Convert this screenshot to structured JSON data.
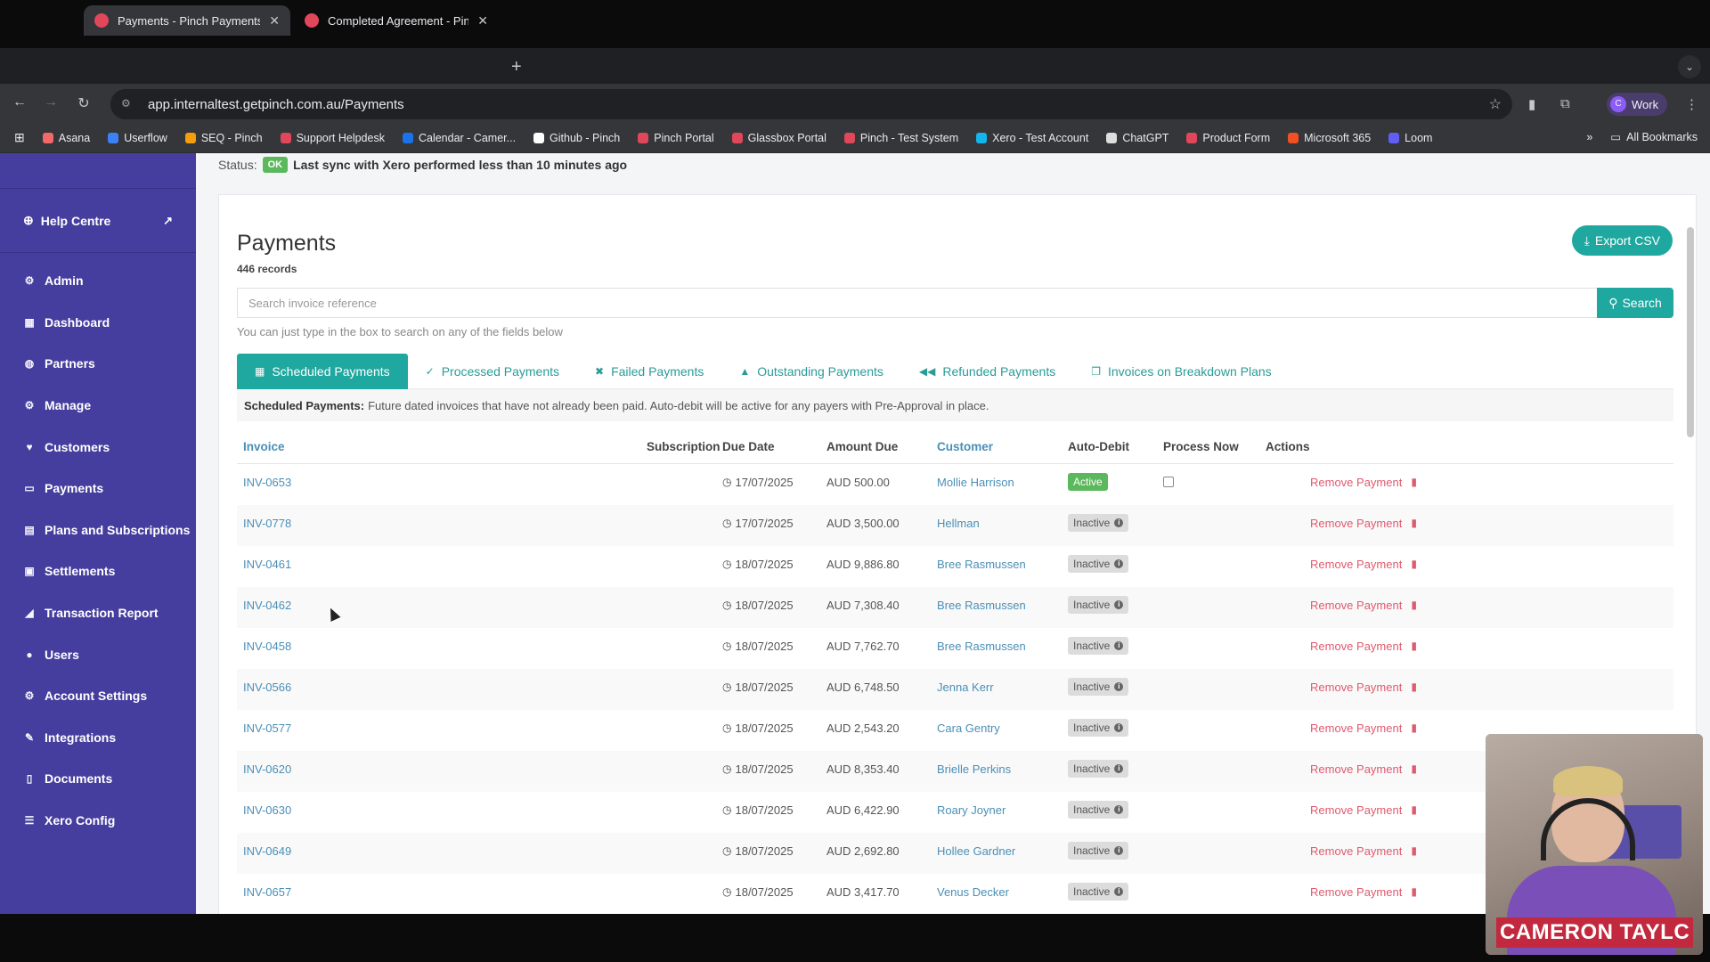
{
  "browser": {
    "tabs": [
      {
        "title": "Payments - Pinch Payments"
      },
      {
        "title": "Completed Agreement - Pinch"
      }
    ],
    "url": "app.internaltest.getpinch.com.au/Payments",
    "profile_label": "Work",
    "profile_initial": "C",
    "bookmarks": [
      {
        "label": "Asana",
        "color": "#f06a6a"
      },
      {
        "label": "Userflow",
        "color": "#3b82f6"
      },
      {
        "label": "SEQ - Pinch",
        "color": "#f59e0b"
      },
      {
        "label": "Support Helpdesk",
        "color": "#e0475b"
      },
      {
        "label": "Calendar - Camer...",
        "color": "#1a73e8"
      },
      {
        "label": "Github - Pinch",
        "color": "#ffffff"
      },
      {
        "label": "Pinch Portal",
        "color": "#e0475b"
      },
      {
        "label": "Glassbox Portal",
        "color": "#e0475b"
      },
      {
        "label": "Pinch - Test System",
        "color": "#e0475b"
      },
      {
        "label": "Xero - Test Account",
        "color": "#13b5ea"
      },
      {
        "label": "ChatGPT",
        "color": "#dddddd"
      },
      {
        "label": "Product Form",
        "color": "#e0475b"
      },
      {
        "label": "Microsoft 365",
        "color": "#f25022"
      },
      {
        "label": "Loom",
        "color": "#625df5"
      }
    ],
    "all_bookmarks_label": "All Bookmarks"
  },
  "sidebar": {
    "help_label": "Help Centre",
    "items": [
      {
        "label": "Admin",
        "icon": "gear-icon"
      },
      {
        "label": "Dashboard",
        "icon": "grid-icon"
      },
      {
        "label": "Partners",
        "icon": "globe-icon"
      },
      {
        "label": "Manage",
        "icon": "gear-icon"
      },
      {
        "label": "Customers",
        "icon": "heart-icon"
      },
      {
        "label": "Payments",
        "icon": "card-icon"
      },
      {
        "label": "Plans and Subscriptions",
        "icon": "file-icon"
      },
      {
        "label": "Settlements",
        "icon": "money-icon"
      },
      {
        "label": "Transaction Report",
        "icon": "chart-icon"
      },
      {
        "label": "Users",
        "icon": "users-icon"
      },
      {
        "label": "Account Settings",
        "icon": "gear-icon"
      },
      {
        "label": "Integrations",
        "icon": "pencil-icon"
      },
      {
        "label": "Documents",
        "icon": "document-icon"
      },
      {
        "label": "Xero Config",
        "icon": "list-icon"
      }
    ]
  },
  "status": {
    "label": "Status:",
    "badge": "OK",
    "message": "Last sync with Xero performed less than 10 minutes ago"
  },
  "page": {
    "title": "Payments",
    "record_count": "446 records",
    "export_label": "Export CSV",
    "search_placeholder": "Search invoice reference",
    "search_button": "Search",
    "hint": "You can just type in the box to search on any of the fields below"
  },
  "tabs": [
    {
      "label": "Scheduled Payments",
      "icon": "calendar-icon"
    },
    {
      "label": "Processed Payments",
      "icon": "check-icon"
    },
    {
      "label": "Failed Payments",
      "icon": "x-icon"
    },
    {
      "label": "Outstanding Payments",
      "icon": "warning-icon"
    },
    {
      "label": "Refunded Payments",
      "icon": "rewind-icon"
    },
    {
      "label": "Invoices on Breakdown Plans",
      "icon": "copy-icon"
    }
  ],
  "description": {
    "title": "Scheduled Payments:",
    "text": "Future dated invoices that have not already been paid. Auto-debit will be active for any payers with Pre-Approval in place."
  },
  "table": {
    "columns": [
      "Invoice",
      "Subscription",
      "Due Date",
      "Amount Due",
      "Customer",
      "Auto-Debit",
      "Process Now",
      "Actions"
    ],
    "remove_label": "Remove Payment",
    "rows": [
      {
        "invoice": "INV-0653",
        "due": "17/07/2025",
        "amount": "AUD 500.00",
        "customer": "Mollie Harrison",
        "auto_debit": "Active"
      },
      {
        "invoice": "INV-0778",
        "due": "17/07/2025",
        "amount": "AUD 3,500.00",
        "customer": "Hellman",
        "auto_debit": "Inactive"
      },
      {
        "invoice": "INV-0461",
        "due": "18/07/2025",
        "amount": "AUD 9,886.80",
        "customer": "Bree Rasmussen",
        "auto_debit": "Inactive"
      },
      {
        "invoice": "INV-0462",
        "due": "18/07/2025",
        "amount": "AUD 7,308.40",
        "customer": "Bree Rasmussen",
        "auto_debit": "Inactive"
      },
      {
        "invoice": "INV-0458",
        "due": "18/07/2025",
        "amount": "AUD 7,762.70",
        "customer": "Bree Rasmussen",
        "auto_debit": "Inactive"
      },
      {
        "invoice": "INV-0566",
        "due": "18/07/2025",
        "amount": "AUD 6,748.50",
        "customer": "Jenna Kerr",
        "auto_debit": "Inactive"
      },
      {
        "invoice": "INV-0577",
        "due": "18/07/2025",
        "amount": "AUD 2,543.20",
        "customer": "Cara Gentry",
        "auto_debit": "Inactive"
      },
      {
        "invoice": "INV-0620",
        "due": "18/07/2025",
        "amount": "AUD 8,353.40",
        "customer": "Brielle Perkins",
        "auto_debit": "Inactive"
      },
      {
        "invoice": "INV-0630",
        "due": "18/07/2025",
        "amount": "AUD 6,422.90",
        "customer": "Roary Joyner",
        "auto_debit": "Inactive"
      },
      {
        "invoice": "INV-0649",
        "due": "18/07/2025",
        "amount": "AUD 2,692.80",
        "customer": "Hollee Gardner",
        "auto_debit": "Inactive"
      },
      {
        "invoice": "INV-0657",
        "due": "18/07/2025",
        "amount": "AUD 3,417.70",
        "customer": "Venus Decker",
        "auto_debit": "Inactive"
      }
    ]
  },
  "webcam": {
    "name_tag": "CAMERON TAYLC"
  }
}
